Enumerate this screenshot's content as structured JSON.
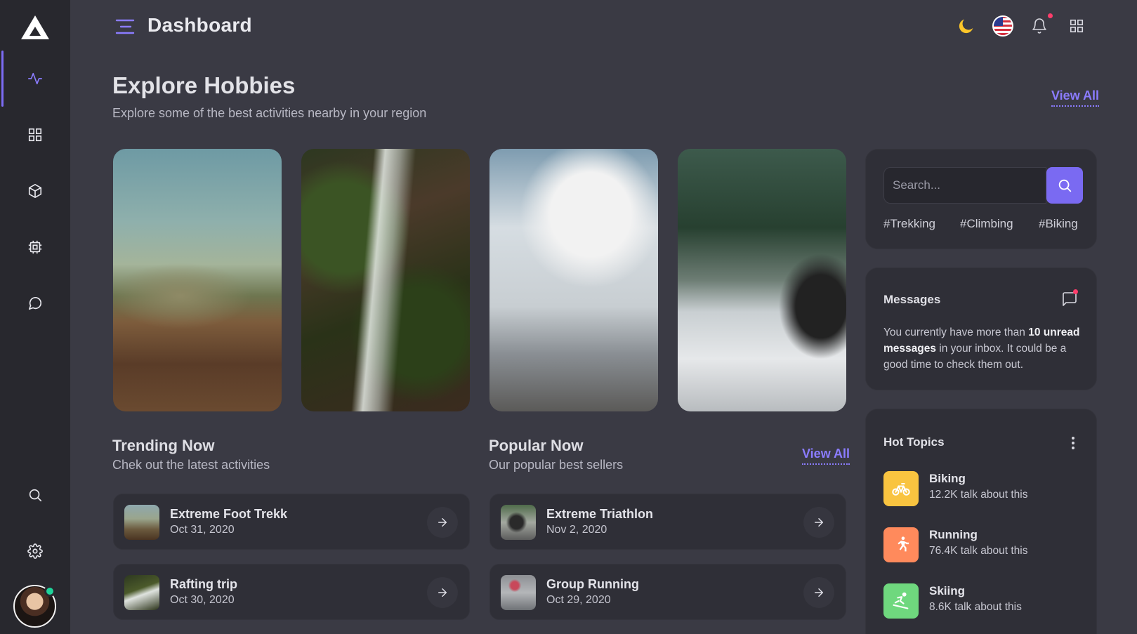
{
  "header": {
    "title": "Dashboard",
    "icons": [
      "menu-icon",
      "moon-icon",
      "us-flag-icon",
      "bell-icon",
      "apps-grid-icon"
    ]
  },
  "sidebar": {
    "items": [
      "activity-icon",
      "grid-icon",
      "box-icon",
      "chip-icon",
      "chat-icon",
      "search-icon",
      "gear-icon"
    ],
    "accent": "#7c6cf4",
    "status_color": "#1fd39a"
  },
  "explore": {
    "title": "Explore Hobbies",
    "subtitle": "Explore some of the best activities nearby in your region",
    "view_all": "View All"
  },
  "trending": {
    "title": "Trending Now",
    "subtitle": "Chek out the latest activities",
    "items": [
      {
        "name": "Extreme Foot Trekk",
        "date": "Oct 31, 2020"
      },
      {
        "name": "Rafting trip",
        "date": "Oct 30, 2020"
      }
    ]
  },
  "popular": {
    "title": "Popular Now",
    "subtitle": "Our popular best sellers",
    "view_all": "View All",
    "items": [
      {
        "name": "Extreme Triathlon",
        "date": "Nov 2, 2020"
      },
      {
        "name": "Group Running",
        "date": "Oct 29, 2020"
      }
    ]
  },
  "search": {
    "placeholder": "Search...",
    "tags": [
      "#Trekking",
      "#Climbing",
      "#Biking"
    ]
  },
  "messages": {
    "title": "Messages",
    "text_before": "You currently have more than ",
    "text_bold": "10 unread messages",
    "text_after": " in your inbox. It could be a good time to check them out."
  },
  "hot_topics": {
    "title": "Hot Topics",
    "items": [
      {
        "name": "Biking",
        "count": "12.2K talk about this",
        "color": "#f9c440"
      },
      {
        "name": "Running",
        "count": "76.4K talk about this",
        "color": "#ff8a5c"
      },
      {
        "name": "Skiing",
        "count": "8.6K talk about this",
        "color": "#6fd87e"
      }
    ]
  }
}
